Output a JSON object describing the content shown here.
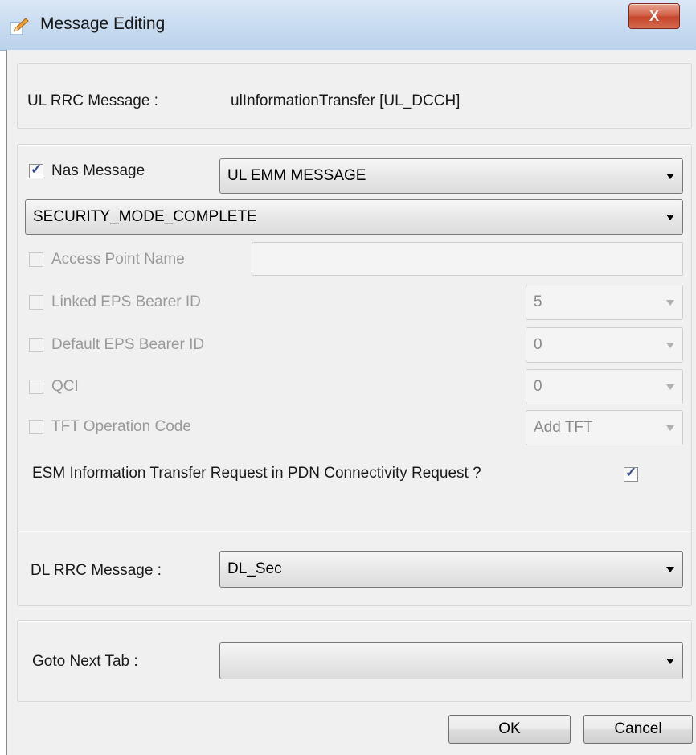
{
  "window": {
    "title": "Message Editing",
    "close_label": "X"
  },
  "ul_rrc": {
    "label": "UL RRC Message :",
    "value": "ulInformationTransfer [UL_DCCH]"
  },
  "nas": {
    "checkbox_label": "Nas Message",
    "checked": true,
    "type_select": "UL EMM MESSAGE",
    "message_select": "SECURITY_MODE_COMPLETE",
    "access_point_name": {
      "label": "Access Point Name",
      "value": ""
    },
    "linked_eps_bearer_id": {
      "label": "Linked  EPS Bearer ID",
      "value": "5"
    },
    "default_eps_bearer_id": {
      "label": "Default EPS Bearer ID",
      "value": "0"
    },
    "qci": {
      "label": "QCI",
      "value": "0"
    },
    "tft_operation_code": {
      "label": "TFT Operation Code",
      "value": "Add TFT"
    },
    "esm_info_request": {
      "label": "ESM Information Transfer Request in PDN Connectivity Request ?",
      "checked": true
    }
  },
  "dl_rrc": {
    "label": "DL RRC Message :",
    "value": "DL_Sec"
  },
  "goto_next_tab": {
    "label": "Goto Next Tab :",
    "value": ""
  },
  "buttons": {
    "ok": "OK",
    "cancel": "Cancel"
  },
  "icons": {
    "title": "pencil-edit-icon",
    "close": "close-icon",
    "dropdown": "chevron-down-icon"
  },
  "colors": {
    "titlebar": "#c9dcf0",
    "close_button": "#c4442a",
    "panel": "#f0f0f0",
    "disabled_text": "#9a9a9a"
  }
}
